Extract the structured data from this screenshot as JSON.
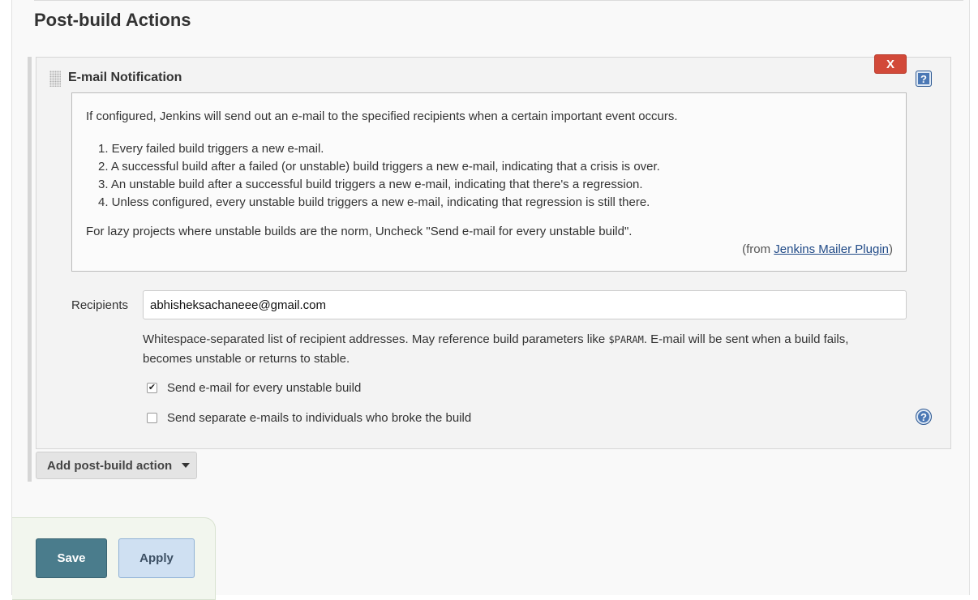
{
  "section": {
    "title": "Post-build Actions"
  },
  "step": {
    "title": "E-mail Notification",
    "delete_label": "X",
    "help_glyph": "?"
  },
  "help": {
    "intro": "If configured, Jenkins will send out an e-mail to the specified recipients when a certain important event occurs.",
    "items": [
      "1. Every failed build triggers a new e-mail.",
      "2. A successful build after a failed (or unstable) build triggers a new e-mail, indicating that a crisis is over.",
      "3. An unstable build after a successful build triggers a new e-mail, indicating that there's a regression.",
      "4. Unless configured, every unstable build triggers a new e-mail, indicating that regression is still there."
    ],
    "lazy": "For lazy projects where unstable builds are the norm, Uncheck \"Send e-mail for every unstable build\".",
    "from_prefix": "(from ",
    "from_link": "Jenkins Mailer Plugin",
    "from_suffix": ")"
  },
  "recipients": {
    "label": "Recipients",
    "value": "abhisheksachaneee@gmail.com",
    "desc_pre": "Whitespace-separated list of recipient addresses. May reference build parameters like ",
    "desc_code": "$PARAM",
    "desc_post": ". E-mail will be sent when a build fails, becomes unstable or returns to stable."
  },
  "options": {
    "unstable": {
      "label": "Send e-mail for every unstable build",
      "checked": true
    },
    "individuals": {
      "label": "Send separate e-mails to individuals who broke the build",
      "checked": false
    }
  },
  "add_action": {
    "label": "Add post-build action"
  },
  "footer": {
    "save_label": "Save",
    "apply_label": "Apply"
  },
  "icons": {
    "checkmark": "✔",
    "question": "?"
  },
  "colors": {
    "delete": "#d24939",
    "save": "#4a7c8c",
    "apply": "#cfe0f2",
    "help_icon": "#4b78b5"
  }
}
